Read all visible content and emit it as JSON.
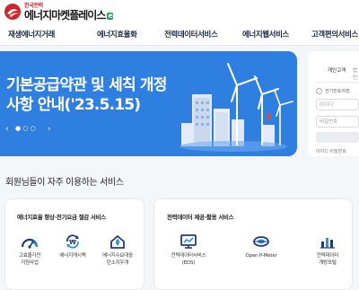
{
  "header": {
    "logo_small": "한국전력",
    "logo_main": "에너지마켓플레이스",
    "logo_badge": "e"
  },
  "nav": {
    "items": [
      "재생에너지거래",
      "에너지효율화",
      "전력데이터서비스",
      "에너지웹서비스",
      "고객편의서비스"
    ]
  },
  "banner": {
    "title_line1": "기본공급약관 및 세칙 개정",
    "title_line2": "사항 안내('23.5.15)"
  },
  "login": {
    "tab_individual": "개인고객",
    "tab_business": "법인",
    "save_id_label": "전기번호저장",
    "id_placeholder": "아이디",
    "pw_placeholder": "비밀번호",
    "find_link": "아이디 비밀번호"
  },
  "services": {
    "title": "회원님들이 자주 이용하는 서비스",
    "cards": [
      {
        "title": "에너지효율 향상·전기요금 절감 서비스",
        "items": [
          {
            "label": "고효율가전\n지원사업",
            "icon": "gauge-icon"
          },
          {
            "label": "에너지캐시백",
            "icon": "cashback-icon"
          },
          {
            "label": "에너지수요대응\n탄소지우개",
            "icon": "eco-home-icon"
          }
        ]
      },
      {
        "title": "전력데이터 제공·활용 서비스",
        "items": [
          {
            "label": "전력데이터서비스\n(EDS)",
            "icon": "monitor-icon"
          },
          {
            "label": "Open P-Meter",
            "icon": "meter-icon"
          },
          {
            "label": "전력데이터\n개방포털",
            "icon": "chart-icon"
          }
        ]
      }
    ]
  },
  "colors": {
    "banner_bg": "#2f7fe0",
    "brand_red": "#d2232a",
    "brand_green": "#1fa05a",
    "icon_navy": "#1e3c78",
    "icon_blue": "#2e8fe6"
  }
}
